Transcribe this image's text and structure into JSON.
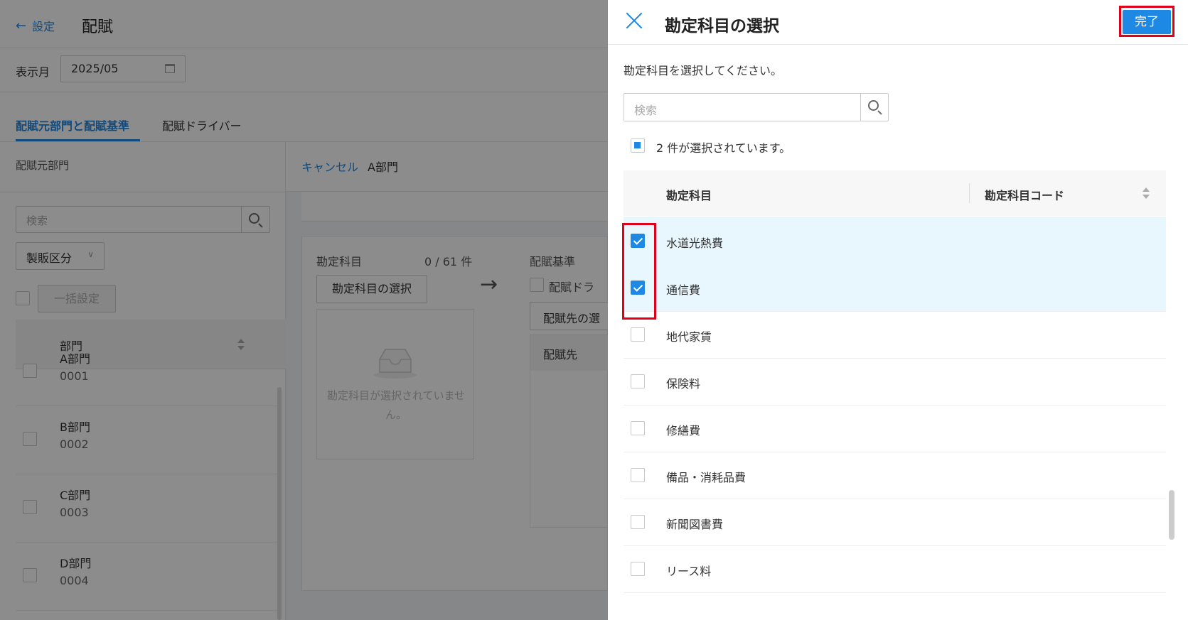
{
  "page": {
    "back_label": "設定",
    "title": "配賦",
    "month_label": "表示月",
    "month_value": "2025/05",
    "tabs": [
      {
        "label": "配賦元部門と配賦基準"
      },
      {
        "label": "配賦ドライバー"
      }
    ],
    "left": {
      "heading": "配賦元部門",
      "search_placeholder": "検索",
      "filter_label": "製販区分",
      "bulk_button": "一括設定",
      "column_header": "部門",
      "rows": [
        {
          "name": "A部門",
          "code": "0001"
        },
        {
          "name": "B部門",
          "code": "0002"
        },
        {
          "name": "C部門",
          "code": "0003"
        },
        {
          "name": "D部門",
          "code": "0004"
        }
      ]
    },
    "middle": {
      "cancel_label": "キャンセル",
      "dept_label": "A部門",
      "account_label": "勘定科目",
      "account_count": "0 / 61 件",
      "select_button": "勘定科目の選択",
      "empty_text": "勘定科目が選択されていません。",
      "basis_label": "配賦基準",
      "driver_checkbox_label": "配賦ドラ",
      "dest_button": "配賦先の選",
      "dest_column": "配賦先"
    }
  },
  "drawer": {
    "title": "勘定科目の選択",
    "done_label": "完了",
    "instruction": "勘定科目を選択してください。",
    "search_placeholder": "検索",
    "selected_text": "2 件が選択されています。",
    "columns": {
      "name": "勘定科目",
      "code": "勘定科目コード"
    },
    "rows": [
      {
        "name": "水道光熱費",
        "checked": true
      },
      {
        "name": "通信費",
        "checked": true
      },
      {
        "name": "地代家賃",
        "checked": false
      },
      {
        "name": "保険料",
        "checked": false
      },
      {
        "name": "修繕費",
        "checked": false
      },
      {
        "name": "備品・消耗品費",
        "checked": false
      },
      {
        "name": "新聞図書費",
        "checked": false
      },
      {
        "name": "リース料",
        "checked": false
      }
    ]
  },
  "colors": {
    "accent": "#1e88e5",
    "highlight": "#e0001b",
    "row_checked": "#e8f6fd"
  }
}
